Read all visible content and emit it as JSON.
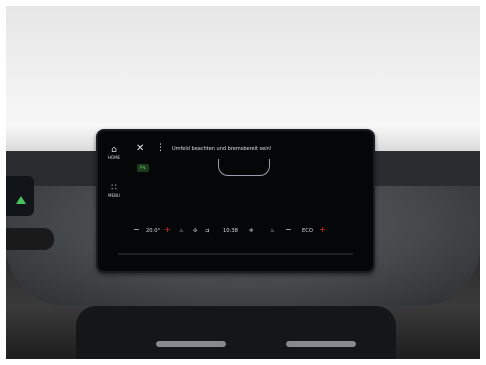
{
  "screen": {
    "sidebar": {
      "home_label": "HOME",
      "menu_label": "MENU"
    },
    "notification": "Umfeld beachten und bremsbereit sein!",
    "status_badge": "P↯",
    "climate_bar": {
      "left_temp": "20.0°",
      "clock": "10:38",
      "mode": "ECO"
    }
  }
}
